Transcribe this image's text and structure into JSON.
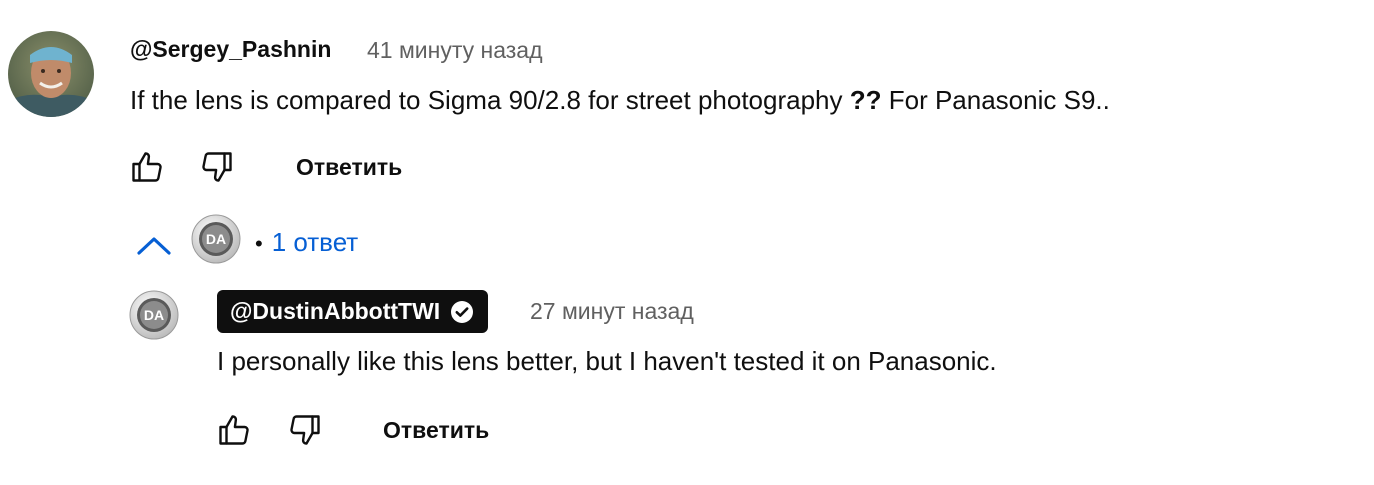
{
  "comment": {
    "author": "@Sergey_Pashnin",
    "timestamp": "41 минуту назад",
    "text_part1": "If the lens is compared to Sigma 90/2.8 for street photography ",
    "text_emphasis": "??",
    "text_part2": " For Panasonic S9..",
    "reply_label": "Ответить"
  },
  "replies_toggle": {
    "bullet": "•",
    "count_label": "1 ответ",
    "avatar_initials": "DA"
  },
  "reply": {
    "author": "@DustinAbbottTWI",
    "timestamp": "27 минут назад",
    "text": "I personally like this lens better, but I haven't tested it on Panasonic.",
    "reply_label": "Ответить",
    "avatar_initials": "DA"
  },
  "colors": {
    "link_blue": "#065fd4",
    "secondary_text": "#606060",
    "owner_badge_bg": "#0f0f0f"
  }
}
